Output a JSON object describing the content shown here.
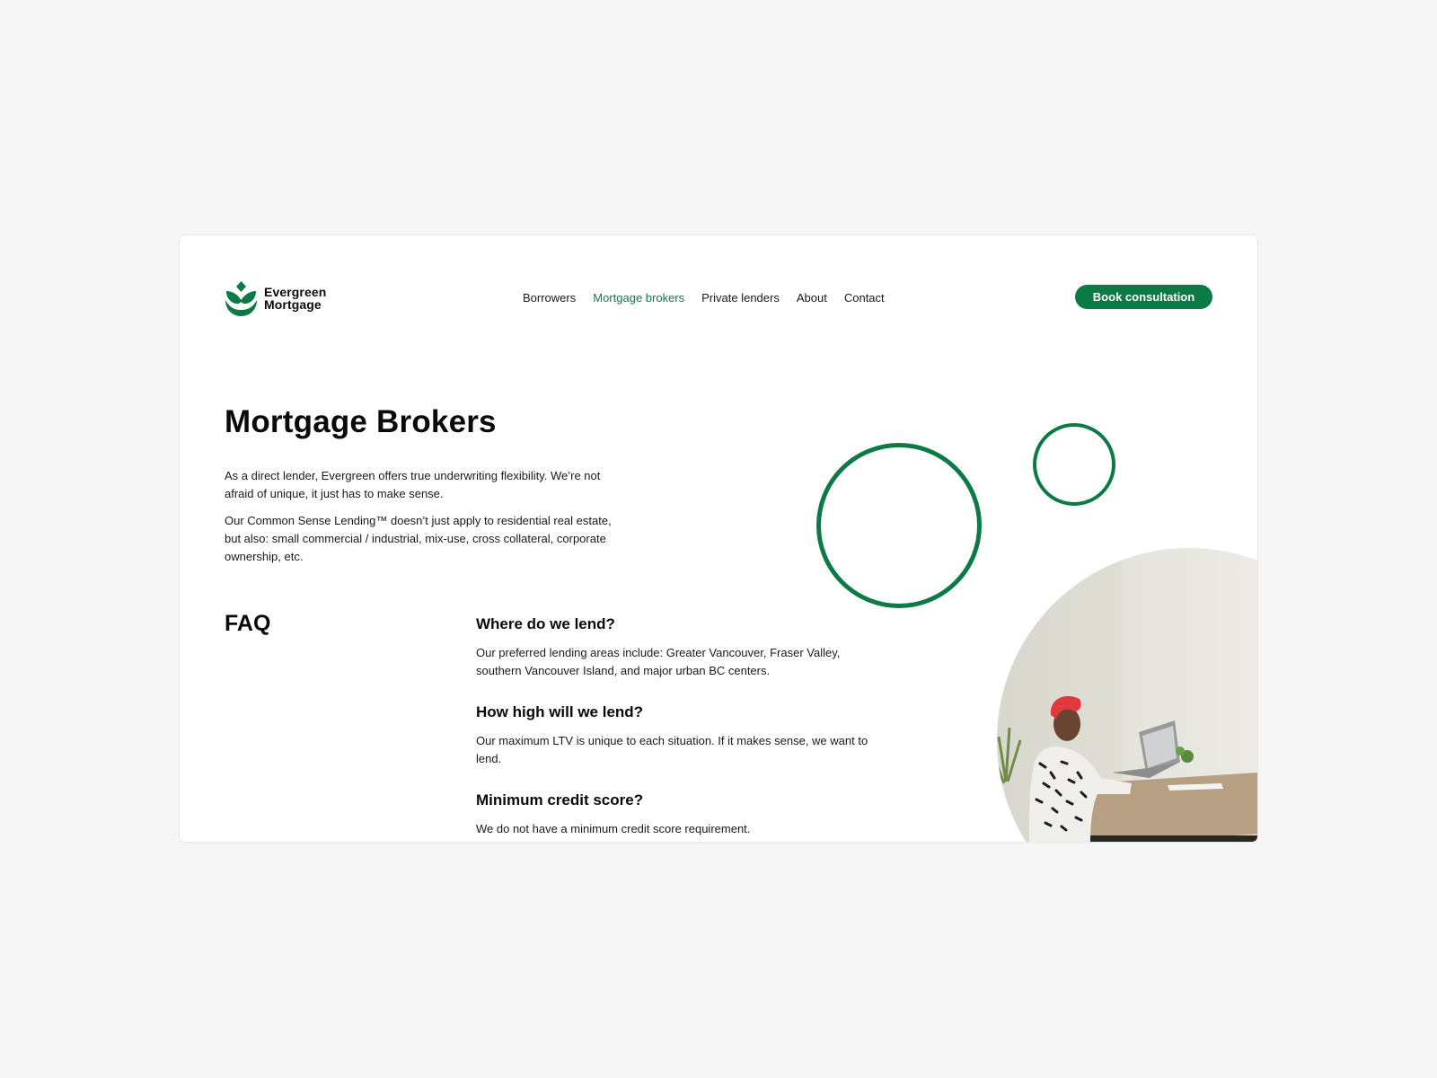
{
  "brand": {
    "name_line1": "Evergreen",
    "name_line2": "Mortgage",
    "logo_icon": "evergreen-leaf-logo",
    "accent_color": "#0b7a45"
  },
  "nav": {
    "items": [
      {
        "label": "Borrowers",
        "active": false
      },
      {
        "label": "Mortgage brokers",
        "active": true
      },
      {
        "label": "Private lenders",
        "active": false
      },
      {
        "label": "About",
        "active": false
      },
      {
        "label": "Contact",
        "active": false
      }
    ],
    "cta_label": "Book consultation"
  },
  "hero": {
    "title": "Mortgage Brokers",
    "paragraphs": [
      "As a direct lender, Evergreen offers true underwriting flexibility. We’re not afraid of unique, it just has to make sense.",
      "Our Common Sense Lending™ doesn’t just apply to residential real estate, but also: small commercial / industrial, mix-use, cross collateral, corporate ownership, etc."
    ]
  },
  "faq": {
    "title": "FAQ",
    "items": [
      {
        "question": "Where do we lend?",
        "answer": "Our preferred lending areas include: Greater Vancouver, Fraser Valley, southern Vancouver Island, and major urban BC centers."
      },
      {
        "question": "How high will we lend?",
        "answer": "Our maximum LTV is unique to each situation. If it makes sense, we want to lend."
      },
      {
        "question": "Minimum credit score?",
        "answer": "We do not have a minimum credit score requirement."
      }
    ]
  },
  "decorations": {
    "rings": [
      "large-green-ring",
      "small-green-ring"
    ],
    "photo": "meeting-photo"
  }
}
